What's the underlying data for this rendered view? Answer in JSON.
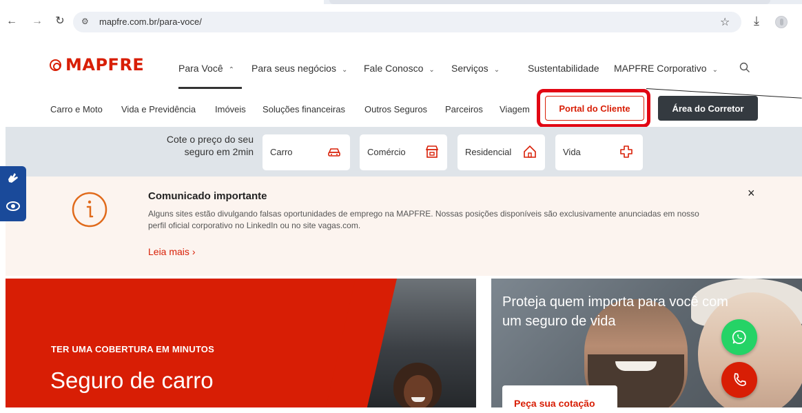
{
  "browser": {
    "url": "mapfre.com.br/para-voce/",
    "icons": [
      "back-icon",
      "forward-icon",
      "reload-icon",
      "site-info-icon",
      "bookmark-star-icon",
      "download-icon",
      "profile-avatar"
    ]
  },
  "header": {
    "logo_text": "MAPFRE",
    "nav": {
      "para_voce": "Para Você",
      "negocios": "Para seus negócios",
      "fale": "Fale Conosco",
      "servicos": "Serviços",
      "sustentabilidade": "Sustentabilidade",
      "corporativo": "MAPFRE Corporativo"
    },
    "subnav": {
      "carro_moto": "Carro e Moto",
      "vida_prev": "Vida e Previdência",
      "imoveis": "Imóveis",
      "solucoes": "Soluções financeiras",
      "outros": "Outros Seguros",
      "parceiros": "Parceiros",
      "viagem": "Viagem"
    },
    "portal_label": "Portal do Cliente",
    "corretor_label": "Área do Corretor"
  },
  "quote": {
    "prompt": "Cote o preço do seu seguro em 2min",
    "cards": [
      "Carro",
      "Comércio",
      "Residencial",
      "Vida"
    ]
  },
  "notice": {
    "title": "Comunicado importante",
    "body": "Alguns sites estão divulgando falsas oportunidades de emprego na MAPFRE. Nossas posições disponíveis são exclusivamente anunciadas em nosso perfil oficial corporativo no LinkedIn ou no site vagas.com.",
    "link": "Leia mais",
    "close": "×"
  },
  "hero_car": {
    "kicker": "TER UMA COBERTURA EM MINUTOS",
    "title": "Seguro de carro"
  },
  "hero_life": {
    "title": "Proteja quem importa para você com um seguro de vida",
    "cta": "Peça sua cotação"
  },
  "colors": {
    "brand_red": "#d81e05",
    "highlight_red": "#e20613",
    "dark_button": "#343a40",
    "accessibility_blue": "#1a4a9a",
    "whatsapp_green": "#25d366"
  }
}
